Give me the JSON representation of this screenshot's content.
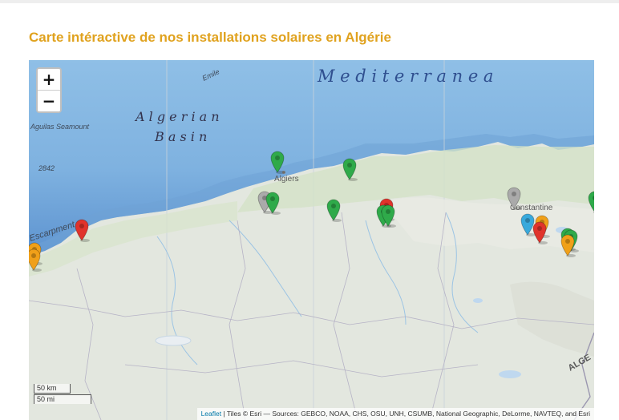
{
  "page": {
    "title": "Carte intéractive de nos installations solaires en Algérie"
  },
  "map": {
    "labels": {
      "sea": "M e d i t e r r a n e a",
      "basin_line1": "A l g e r i a n",
      "basin_line2": "B a s i n",
      "seamount": "Aguilas Seamount",
      "depth": "2842",
      "emile": "Emile",
      "escarpment": "Escarpment",
      "algiers": "Algiers",
      "constantine": "Constantine",
      "algeria": "ALGE"
    },
    "controls": {
      "zoom_in": "+",
      "zoom_out": "−"
    },
    "scale": {
      "km": "50 km",
      "mi": "50 mi"
    },
    "attribution": {
      "leaflet": "Leaflet",
      "text": " | Tiles © Esri — Sources: GEBCO, NOAA, CHS, OSU, UNH, CSUMB, National Geographic, DeLorme, NAVTEQ, and Esri"
    },
    "marker_colors": {
      "green": "#2faa4a",
      "red": "#e0332b",
      "orange": "#f0a019",
      "blue": "#38a9dc",
      "gray": "#aaaaaa"
    },
    "markers": [
      {
        "name": "marker-green-algiers",
        "color": "green"
      },
      {
        "name": "marker-green-tizi",
        "color": "green"
      },
      {
        "name": "marker-gray-blida",
        "color": "gray"
      },
      {
        "name": "marker-green-medea",
        "color": "green"
      },
      {
        "name": "marker-green-bouira",
        "color": "green"
      },
      {
        "name": "marker-red-bordj",
        "color": "red"
      },
      {
        "name": "marker-green-bordj-1",
        "color": "green"
      },
      {
        "name": "marker-green-bordj-2",
        "color": "green"
      },
      {
        "name": "marker-gray-constantine",
        "color": "gray"
      },
      {
        "name": "marker-green-east-edge",
        "color": "green"
      },
      {
        "name": "marker-blue-ain-mlila",
        "color": "blue"
      },
      {
        "name": "marker-orange-oum-bouaghi",
        "color": "orange"
      },
      {
        "name": "marker-red-oum-bouaghi",
        "color": "red"
      },
      {
        "name": "marker-green-khenchela-1",
        "color": "green"
      },
      {
        "name": "marker-green-khenchela-2",
        "color": "green"
      },
      {
        "name": "marker-orange-khenchela",
        "color": "orange"
      },
      {
        "name": "marker-red-oran",
        "color": "red"
      },
      {
        "name": "marker-orange-west-1",
        "color": "orange"
      },
      {
        "name": "marker-orange-west-2",
        "color": "orange"
      }
    ]
  }
}
